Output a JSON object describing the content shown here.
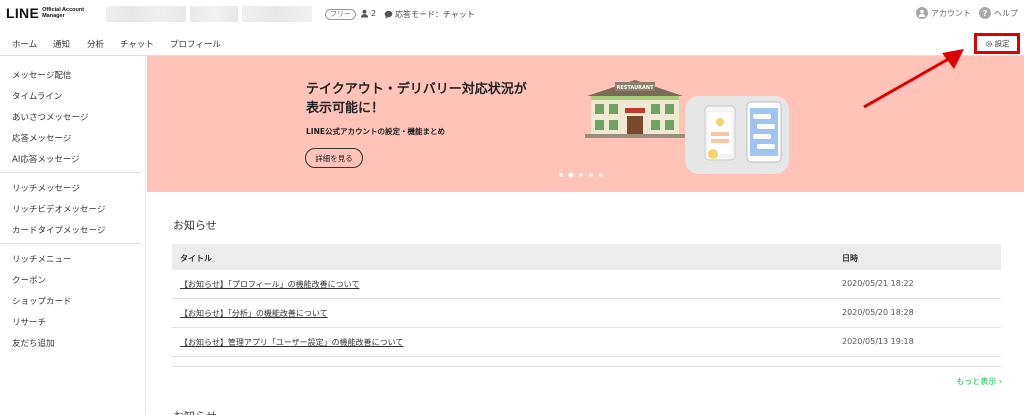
{
  "header": {
    "logo_main": "LINE",
    "logo_sub_1": "Official Account",
    "logo_sub_2": "Manager",
    "plan_badge": "フリー",
    "member_count": "2",
    "response_mode": "応答モード：チャット",
    "account_label": "アカウント",
    "help_label": "ヘルプ",
    "help_glyph": "?"
  },
  "nav": {
    "tabs": [
      {
        "label": "ホーム",
        "active": true
      },
      {
        "label": "通知"
      },
      {
        "label": "分析"
      },
      {
        "label": "チャット"
      },
      {
        "label": "プロフィール"
      }
    ],
    "settings_label": "設定",
    "settings_highlight_color": "#e00000"
  },
  "sidebar": {
    "groups": [
      [
        "メッセージ配信",
        "タイムライン",
        "あいさつメッセージ",
        "応答メッセージ",
        "AI応答メッセージ"
      ],
      [
        "リッチメッセージ",
        "リッチビデオメッセージ",
        "カードタイプメッセージ"
      ],
      [
        "リッチメニュー",
        "クーポン",
        "ショップカード",
        "リサーチ",
        "友だち追加"
      ]
    ]
  },
  "banner": {
    "title_line1": "テイクアウト・デリバリー対応状況が",
    "title_line2": "表示可能に！",
    "subtitle": "LINE公式アカウントの設定・機能まとめ",
    "button": "詳細を見る",
    "illustration_sign": "RESTAURANT",
    "background_color": "#ffc3b8",
    "slide_count": 5,
    "active_slide": 2
  },
  "news": {
    "heading": "お知らせ",
    "columns": [
      "タイトル",
      "日時"
    ],
    "rows": [
      {
        "title": "【お知らせ】「プロフィール」の機能改善について",
        "date": "2020/05/21 18:22"
      },
      {
        "title": "【お知らせ】「分析」の機能改善について",
        "date": "2020/05/20 18:28"
      },
      {
        "title": "【お知らせ】管理アプリ「ユーザー設定」の機能改善について",
        "date": "2020/05/13 19:18"
      }
    ],
    "more_link": "もっと表示 ›"
  },
  "next_section_heading": "お知らせ",
  "colors": {
    "accent": "#06c755",
    "annotation_red": "#e00000"
  }
}
